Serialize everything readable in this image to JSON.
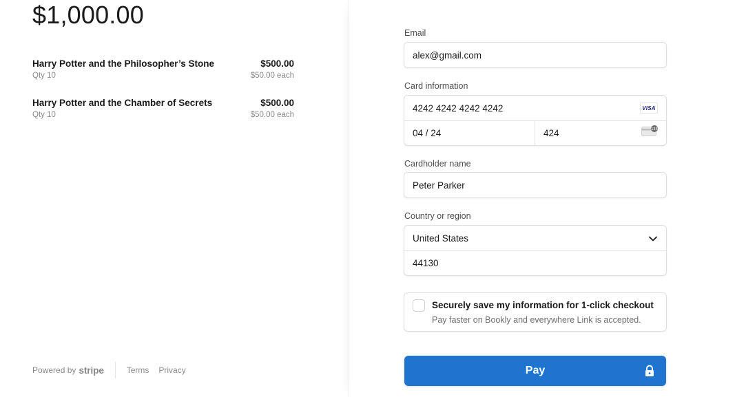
{
  "summary": {
    "total": "$1,000.00",
    "items": [
      {
        "name": "Harry Potter and the Philosopher’s Stone",
        "price": "$500.00",
        "qty": "Qty 10",
        "each": "$50.00 each"
      },
      {
        "name": "Harry Potter and the Chamber of Secrets",
        "price": "$500.00",
        "qty": "Qty 10",
        "each": "$50.00 each"
      }
    ]
  },
  "footer": {
    "powered_by": "Powered by",
    "stripe": "stripe",
    "terms": "Terms",
    "privacy": "Privacy"
  },
  "form": {
    "email": {
      "label": "Email",
      "value": "alex@gmail.com"
    },
    "card": {
      "label": "Card information",
      "number": "4242 4242 4242 4242",
      "brand": "VISA",
      "expiry": "04 / 24",
      "cvc": "424"
    },
    "cardholder": {
      "label": "Cardholder name",
      "value": "Peter Parker"
    },
    "country": {
      "label": "Country or region",
      "value": "United States",
      "zip": "44130"
    },
    "save": {
      "title": "Securely save my information for 1-click checkout",
      "subtitle": "Pay faster on Bookly and everywhere Link is accepted."
    },
    "pay_label": "Pay"
  },
  "colors": {
    "pay_button": "#1f74d0",
    "visa": "#1a1f71"
  },
  "icons": {
    "visa": "visa-card-icon",
    "cvc": "cvc-card-icon",
    "chevron": "chevron-down-icon",
    "lock": "lock-icon"
  }
}
